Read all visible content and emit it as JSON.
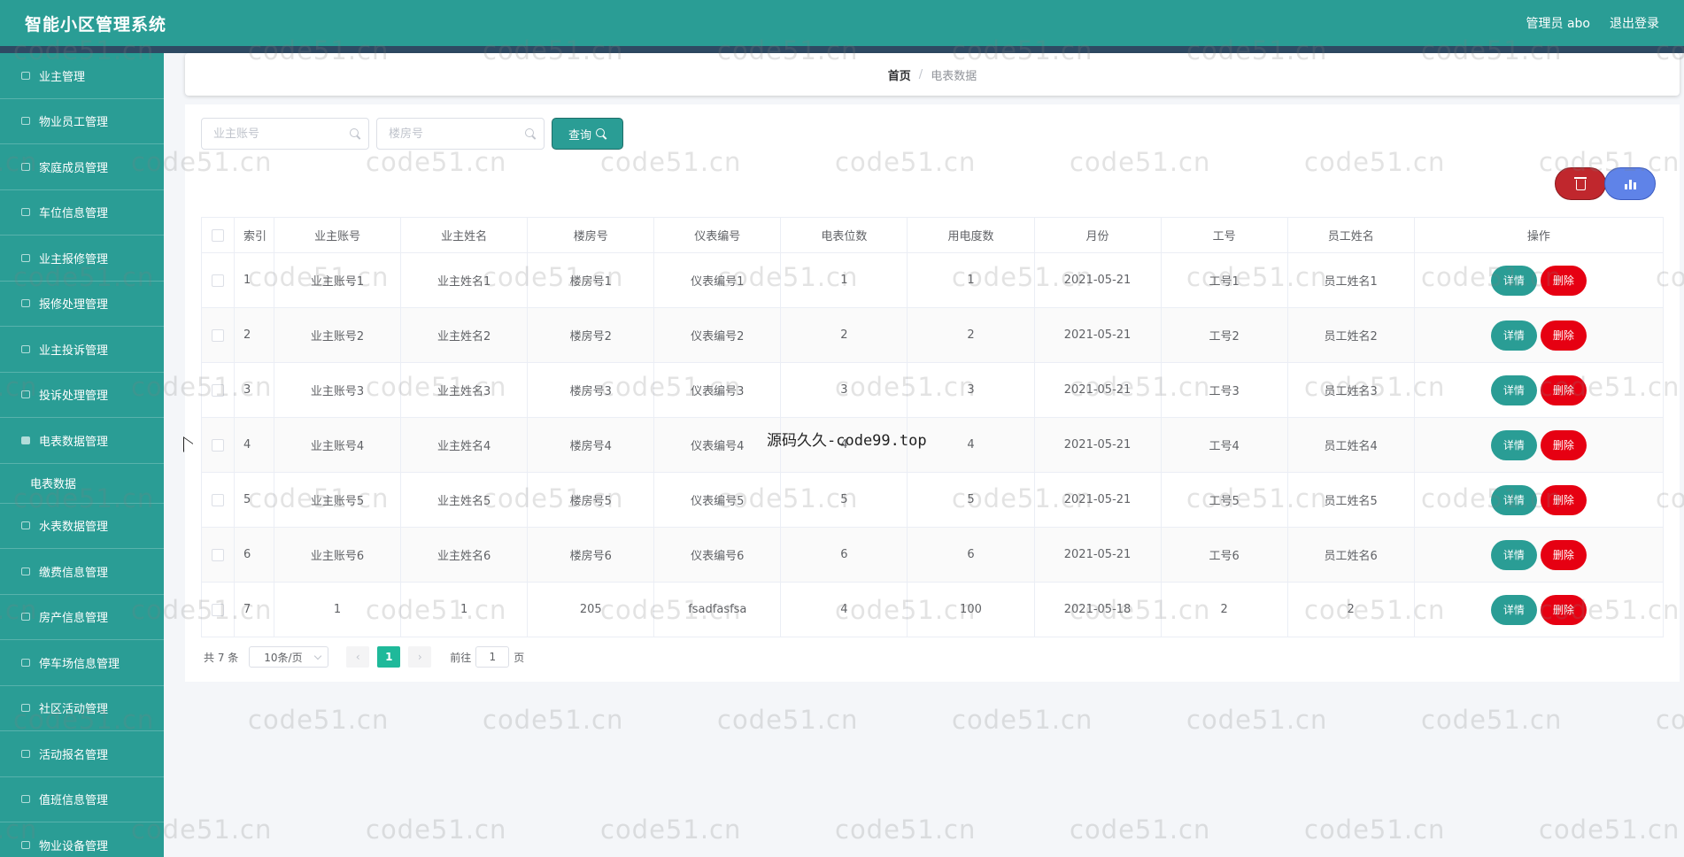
{
  "app": {
    "title": "智能小区管理系统",
    "user_label": "管理员 abo",
    "logout_label": "退出登录"
  },
  "sidebar": {
    "items": [
      {
        "label": "业主管理"
      },
      {
        "label": "物业员工管理"
      },
      {
        "label": "家庭成员管理"
      },
      {
        "label": "车位信息管理"
      },
      {
        "label": "业主报修管理"
      },
      {
        "label": "报修处理管理"
      },
      {
        "label": "业主投诉管理"
      },
      {
        "label": "投诉处理管理"
      },
      {
        "label": "电表数据管理"
      },
      {
        "label": "电表数据"
      },
      {
        "label": "水表数据管理"
      },
      {
        "label": "缴费信息管理"
      },
      {
        "label": "房产信息管理"
      },
      {
        "label": "停车场信息管理"
      },
      {
        "label": "社区活动管理"
      },
      {
        "label": "活动报名管理"
      },
      {
        "label": "值班信息管理"
      },
      {
        "label": "物业设备管理"
      }
    ]
  },
  "breadcrumb": {
    "home": "首页",
    "separator": "/",
    "current": "电表数据"
  },
  "search": {
    "owner_account_placeholder": "业主账号",
    "building_placeholder": "楼房号",
    "query_label": "查询"
  },
  "table": {
    "headers": [
      "索引",
      "业主账号",
      "业主姓名",
      "楼房号",
      "仪表编号",
      "电表位数",
      "用电度数",
      "月份",
      "工号",
      "员工姓名",
      "操作"
    ],
    "rows": [
      [
        "1",
        "业主账号1",
        "业主姓名1",
        "楼房号1",
        "仪表编号1",
        "1",
        "1",
        "2021-05-21",
        "工号1",
        "员工姓名1"
      ],
      [
        "2",
        "业主账号2",
        "业主姓名2",
        "楼房号2",
        "仪表编号2",
        "2",
        "2",
        "2021-05-21",
        "工号2",
        "员工姓名2"
      ],
      [
        "3",
        "业主账号3",
        "业主姓名3",
        "楼房号3",
        "仪表编号3",
        "3",
        "3",
        "2021-05-21",
        "工号3",
        "员工姓名3"
      ],
      [
        "4",
        "业主账号4",
        "业主姓名4",
        "楼房号4",
        "仪表编号4",
        "4",
        "4",
        "2021-05-21",
        "工号4",
        "员工姓名4"
      ],
      [
        "5",
        "业主账号5",
        "业主姓名5",
        "楼房号5",
        "仪表编号5",
        "5",
        "5",
        "2021-05-21",
        "工号5",
        "员工姓名5"
      ],
      [
        "6",
        "业主账号6",
        "业主姓名6",
        "楼房号6",
        "仪表编号6",
        "6",
        "6",
        "2021-05-21",
        "工号6",
        "员工姓名6"
      ],
      [
        "7",
        "1",
        "1",
        "205",
        "fsadfasfsa",
        "4",
        "100",
        "2021-05-18",
        "2",
        "2"
      ]
    ],
    "detail_label": "详情",
    "delete_label": "删除"
  },
  "pagination": {
    "total": "共 7 条",
    "page_size": "10条/页",
    "prev": "‹",
    "next": "›",
    "current_page": "1",
    "goto_prefix": "前往",
    "goto_value": "1",
    "goto_suffix": "页"
  },
  "watermarks": {
    "center": "源码久久-code99.top",
    "repeat": "code51.cn"
  }
}
